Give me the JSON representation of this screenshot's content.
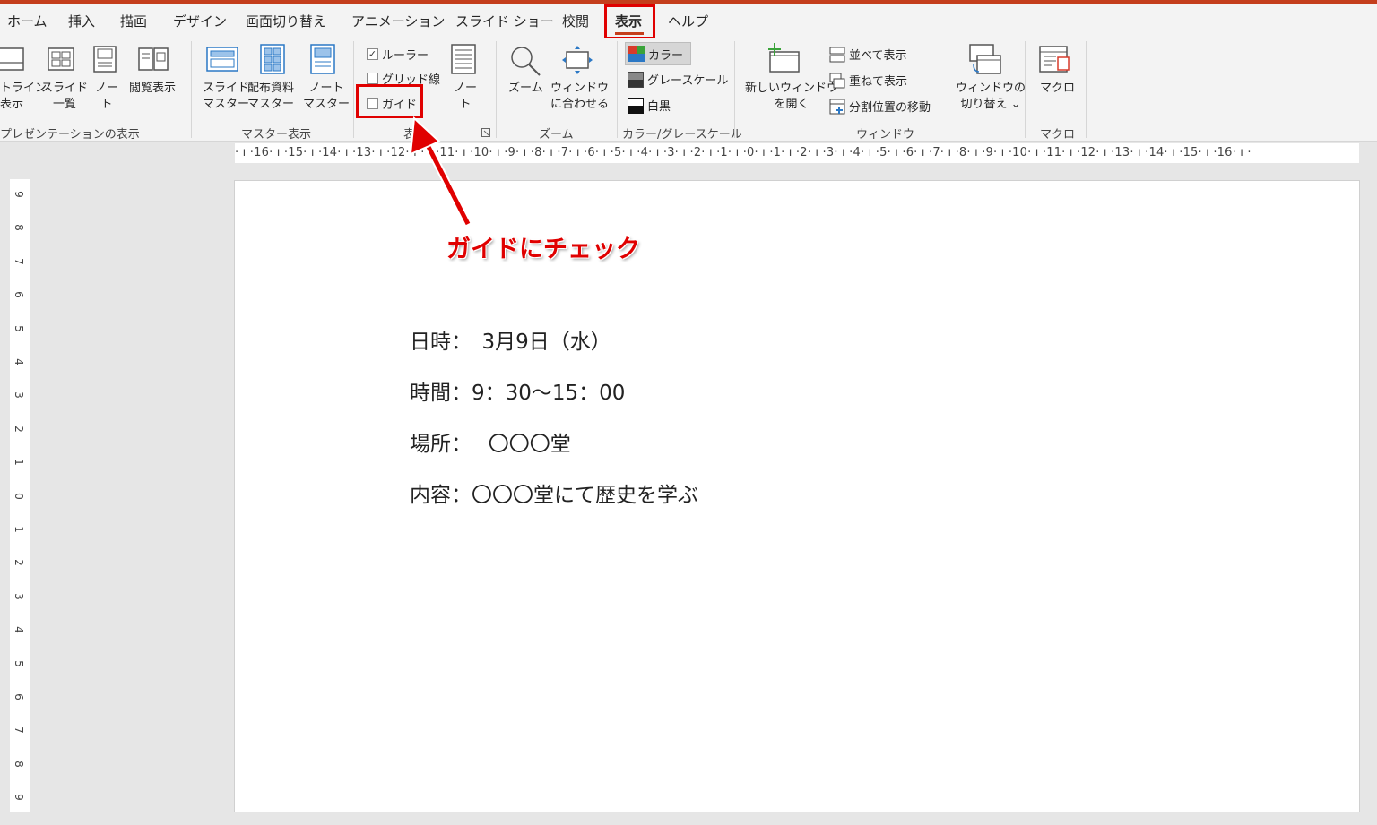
{
  "tabs": [
    "ホーム",
    "挿入",
    "描画",
    "デザイン",
    "画面切り替え",
    "アニメーション",
    "スライド ショー",
    "校閲",
    "表示",
    "ヘルプ"
  ],
  "active_tab": "表示",
  "ribbon": {
    "presentation_views": {
      "outline_view": "トライン\n表示",
      "slide_sorter": "スライド\n一覧",
      "notes_page": "ノー\nト",
      "reading_view": "閲覧表示",
      "group_label": "プレゼンテーションの表示"
    },
    "master_views": {
      "slide_master": "スライド\nマスター",
      "handout_master": "配布資料\nマスター",
      "notes_master": "ノート\nマスター",
      "group_label": "マスター表示"
    },
    "show": {
      "ruler": "ルーラー",
      "ruler_checked": true,
      "gridlines": "グリッド線",
      "gridlines_checked": false,
      "guides": "ガイド",
      "guides_checked": false,
      "notes": "ノー\nト",
      "group_label": "表"
    },
    "zoom": {
      "zoom": "ズーム",
      "fit_to_window": "ウィンドウ\nに合わせる",
      "group_label": "ズーム"
    },
    "color": {
      "color": "カラー",
      "grayscale": "グレースケール",
      "black_white": "白黒",
      "group_label": "カラー/グレースケール"
    },
    "window": {
      "new_window": "新しいウィンドウ\nを開く",
      "arrange_all": "並べて表示",
      "cascade": "重ねて表示",
      "move_split": "分割位置の移動",
      "switch_windows": "ウィンドウの\n切り替え ⌄",
      "group_label": "ウィンドウ"
    },
    "macros": {
      "macros": "マクロ",
      "group_label": "マクロ"
    }
  },
  "hruler_text": "· ı ·16· ı ·15· ı ·14· ı ·13· ı ·12· ı · ı ·11· ı ·10· ı ·9· ı ·8· ı ·7· ı ·6· ı ·5· ı ·4· ı ·3· ı ·2· ı ·1· ı ·0· ı ·1· ı ·2· ı ·3· ı ·4· ı ·5· ı ·6· ı ·7· ı ·8· ı ·9· ı ·10· ı ·11· ı ·12· ı ·13· ı ·14· ı ·15· ı ·16· ı ·",
  "vruler_numbers": [
    "9",
    "8",
    "7",
    "6",
    "5",
    "4",
    "3",
    "2",
    "1",
    "0",
    "1",
    "2",
    "3",
    "4",
    "5",
    "6",
    "7",
    "8",
    "9"
  ],
  "slide": {
    "lines": [
      "日時：　3月9日（水）",
      "時間：9：30〜15：00",
      "場所：　 〇〇〇堂",
      "内容：〇〇〇堂にて歴史を学ぶ"
    ]
  },
  "annotation": "ガイドにチェック",
  "colors": {
    "accent": "#c43e1c",
    "highlight": "#e00000"
  }
}
